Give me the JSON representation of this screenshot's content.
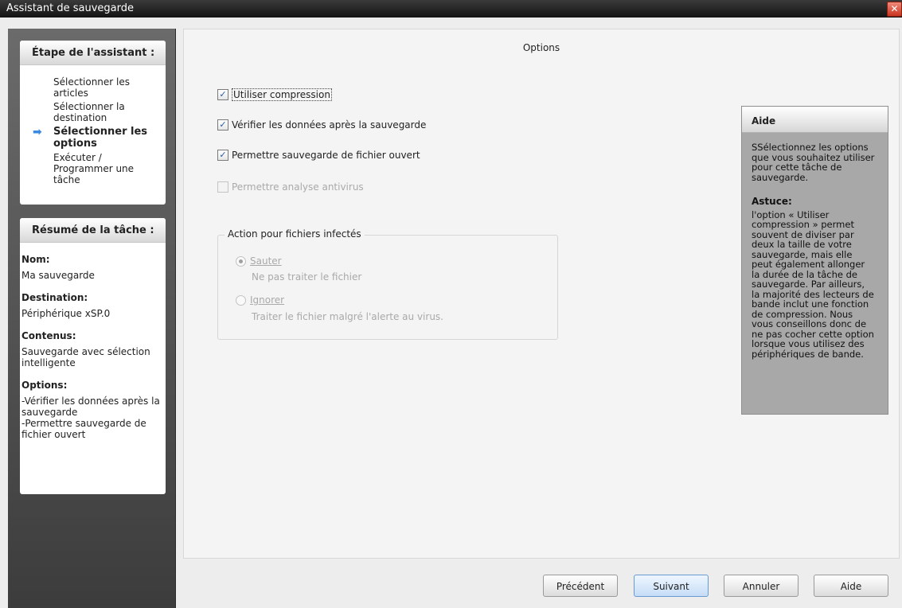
{
  "window": {
    "title": "Assistant de sauvegarde",
    "close_glyph": "✕"
  },
  "wizard": {
    "header": "Étape de l'assistant :",
    "steps": [
      "Sélectionner les articles",
      "Sélectionner la destination",
      "Sélectionner les options",
      "Exécuter / Programmer une tâche"
    ],
    "active_step": 2,
    "active_icon": "right-arrow-icon",
    "active_glyph": "➡"
  },
  "summary": {
    "header": "Résumé de la tâche :",
    "name_label": "Nom:",
    "name_value": "Ma sauvegarde",
    "dest_label": "Destination:",
    "dest_value": "Périphérique xSP.0",
    "contents_label": "Contenus:",
    "contents_value": "Sauvegarde avec sélection intelligente",
    "options_label": "Options:",
    "options_value_1": "-Vérifier les données après la sauvegarde",
    "options_value_2": "-Permettre sauvegarde de fichier ouvert"
  },
  "main": {
    "title": "Options",
    "check_glyph": "✓",
    "options": [
      {
        "label": "Utiliser compression",
        "checked": true,
        "enabled": true
      },
      {
        "label": "Vérifier les données après la sauvegarde",
        "checked": true,
        "enabled": true
      },
      {
        "label": "Permettre sauvegarde de fichier ouvert",
        "checked": true,
        "enabled": true
      },
      {
        "label": "Permettre analyse antivirus",
        "checked": false,
        "enabled": false
      }
    ],
    "infected_group": {
      "legend": "Action pour fichiers infectés",
      "radios": [
        {
          "label": "Sauter",
          "description": "Ne pas traiter le fichier",
          "selected": true
        },
        {
          "label": "Ignorer",
          "description": "Traiter le fichier malgré l'alerte au virus.",
          "selected": false
        }
      ]
    }
  },
  "help": {
    "header": "Aide",
    "text": "SSélectionnez les options que vous souhaitez utiliser pour cette tâche de sauvegarde.",
    "tip_title": "Astuce:",
    "tip_text": "l'option « Utiliser compression » permet souvent de diviser par deux la taille de votre sauvegarde, mais elle peut également allonger la durée de la tâche de sauvegarde.  Par ailleurs, la majorité des lecteurs de bande inclut une fonction de compression. Nous vous conseillons donc de ne pas cocher cette option lorsque vous utilisez des périphériques de bande."
  },
  "buttons": {
    "previous": "Précédent",
    "next": "Suivant",
    "cancel": "Annuler",
    "help": "Aide"
  },
  "colors": {
    "accent": "#3a8be0",
    "titlebar": "#1e1e1e",
    "sidebar": "#555555",
    "help_panel": "#a8a8a8"
  }
}
